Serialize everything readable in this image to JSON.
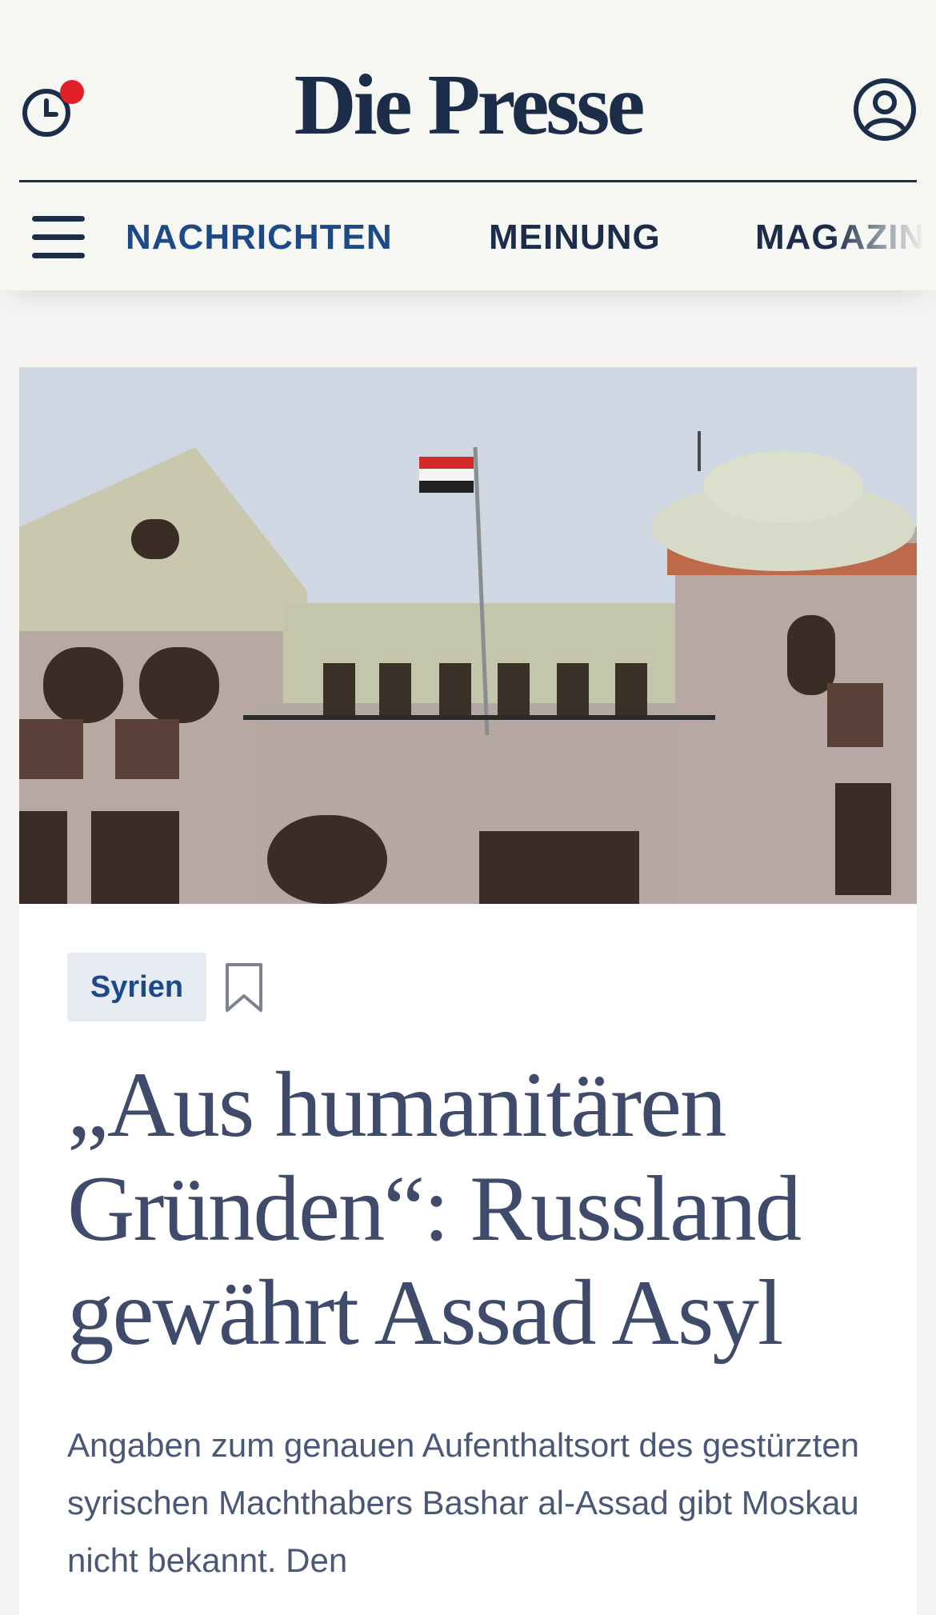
{
  "header": {
    "logo_text": "Die Presse",
    "history_icon": "clock-icon",
    "account_icon": "user-icon",
    "notification_color": "#e3202a",
    "menu_icon": "hamburger-icon"
  },
  "nav": {
    "items": [
      {
        "label": "NACHRICHTEN",
        "active": true
      },
      {
        "label": "MEINUNG",
        "active": false
      },
      {
        "label": "MAGAZIN",
        "active": false
      }
    ]
  },
  "article": {
    "image": "photo of building with Syrian flag on the roof",
    "tag": "Syrien",
    "bookmark_icon": "bookmark-icon",
    "headline": "„Aus humanitären Gründen“: Russland gewährt Assad Asyl",
    "lead": "Angaben zum genauen Aufenthaltsort des gestürzten syrischen Machthabers Bashar al-Assad gibt Moskau nicht bekannt. Den"
  },
  "colors": {
    "brand": "#1c2d4a",
    "accent": "#1d4a86",
    "headline": "#3f4b6a",
    "tag_bg": "#e6ebf2"
  }
}
